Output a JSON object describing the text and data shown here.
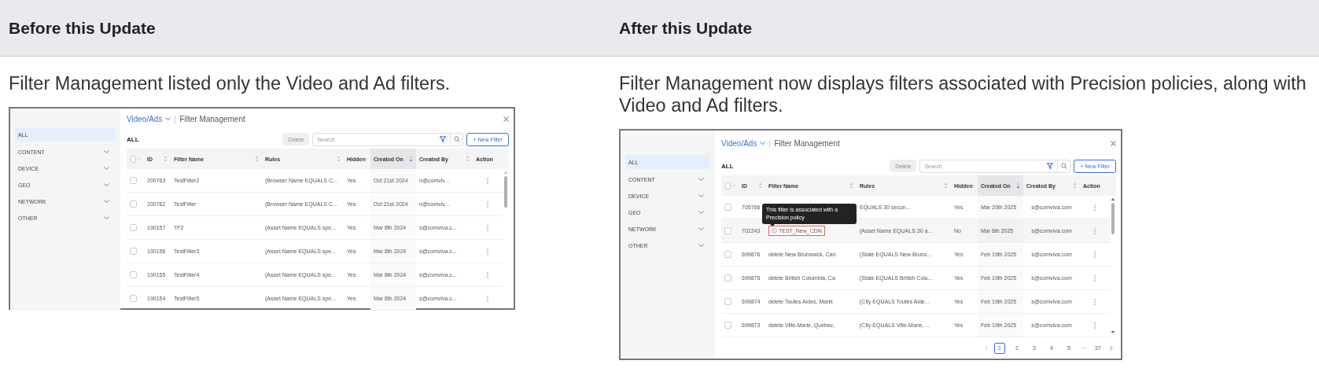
{
  "panels": [
    {
      "heading": "Before this Update",
      "description": "Filter Management listed only the Video and Ad filters.",
      "app": {
        "breadcrumb": "Video/Ads",
        "title": "Filter Management",
        "sidebar": [
          {
            "label": "ALL",
            "selected": true,
            "expandable": false
          },
          {
            "label": "CONTENT",
            "selected": false,
            "expandable": true
          },
          {
            "label": "DEVICE",
            "selected": false,
            "expandable": true
          },
          {
            "label": "GEO",
            "selected": false,
            "expandable": true
          },
          {
            "label": "NETWORK",
            "selected": false,
            "expandable": true
          },
          {
            "label": "OTHER",
            "selected": false,
            "expandable": true
          }
        ],
        "section": "ALL",
        "delete_button": {
          "label": "Delete",
          "disabled": true
        },
        "search": {
          "placeholder": "Search"
        },
        "new_button": "+ New Filter",
        "select_all": {
          "checked": false
        },
        "columns": [
          {
            "label": "ID",
            "sortable": true,
            "sorted": false
          },
          {
            "label": "Filter Name",
            "sortable": true,
            "sorted": false
          },
          {
            "label": "Rules",
            "sortable": true,
            "sorted": false
          },
          {
            "label": "Hidden",
            "sortable": true,
            "sorted": false
          },
          {
            "label": "Created On",
            "sortable": true,
            "sorted": true
          },
          {
            "label": "Created By",
            "sortable": true,
            "sorted": false
          },
          {
            "label": "Action",
            "sortable": false,
            "sorted": false
          }
        ],
        "rows": [
          {
            "checked": false,
            "id": "200763",
            "name": "TestFilter2",
            "rules": "(Browser Name EQUALS C...",
            "hidden": "Yes",
            "created_on": "Oct 21st 2024",
            "created_by": "n@comviv..."
          },
          {
            "checked": false,
            "id": "200762",
            "name": "TestFilter",
            "rules": "(Browser Name EQUALS C...",
            "hidden": "Yes",
            "created_on": "Oct 21st 2024",
            "created_by": "n@comviv..."
          },
          {
            "checked": false,
            "id": "190157",
            "name": "TF2",
            "rules": "(Asset Name EQUALS spe...",
            "hidden": "Yes",
            "created_on": "Mar 8th 2024",
            "created_by": "s@comviva.c..."
          },
          {
            "checked": false,
            "id": "190156",
            "name": "TestFilter3",
            "rules": "(Asset Name EQUALS spe...",
            "hidden": "Yes",
            "created_on": "Mar 8th 2024",
            "created_by": "s@comviva.c..."
          },
          {
            "checked": false,
            "id": "190155",
            "name": "TestFilter4",
            "rules": "(Asset Name EQUALS spe...",
            "hidden": "Yes",
            "created_on": "Mar 8th 2024",
            "created_by": "s@comviva.c..."
          },
          {
            "checked": false,
            "id": "190154",
            "name": "TestFilter5",
            "rules": "(Asset Name EQUALS spe...",
            "hidden": "Yes",
            "created_on": "Mar 8th 2024",
            "created_by": "s@comviva.c..."
          }
        ]
      }
    },
    {
      "heading": "After this Update",
      "description": "Filter Management now displays filters associated with Precision policies, along with Video and Ad filters.",
      "app": {
        "breadcrumb": "Video/Ads",
        "title": "Filter Management",
        "sidebar": [
          {
            "label": "ALL",
            "selected": true,
            "expandable": false
          },
          {
            "label": "CONTENT",
            "selected": false,
            "expandable": true
          },
          {
            "label": "DEVICE",
            "selected": false,
            "expandable": true
          },
          {
            "label": "GEO",
            "selected": false,
            "expandable": true
          },
          {
            "label": "NETWORK",
            "selected": false,
            "expandable": true
          },
          {
            "label": "OTHER",
            "selected": false,
            "expandable": true
          }
        ],
        "section": "ALL",
        "delete_button": {
          "label": "Delete",
          "disabled": true
        },
        "search": {
          "placeholder": "Search"
        },
        "new_button": "+ New Filter",
        "select_all": {
          "checked": false
        },
        "columns": [
          {
            "label": "ID",
            "sortable": true,
            "sorted": false
          },
          {
            "label": "Filter Name",
            "sortable": true,
            "sorted": false
          },
          {
            "label": "Rules",
            "sortable": true,
            "sorted": false
          },
          {
            "label": "Hidden",
            "sortable": true,
            "sorted": false
          },
          {
            "label": "Created On",
            "sortable": true,
            "sorted": true
          },
          {
            "label": "Created By",
            "sortable": true,
            "sorted": false
          },
          {
            "label": "Action",
            "sortable": false,
            "sorted": false
          }
        ],
        "rows": [
          {
            "checked": false,
            "id": "705766",
            "rules": "EQUALS 30 secon...",
            "hidden": "Yes",
            "created_on": "Mar 20th 2025",
            "created_by": "s@comviva.com",
            "hovered": false,
            "flagged": false
          },
          {
            "checked": false,
            "id": "702243",
            "name": "TEST_New_CDN",
            "rules": "(Asset Name EQUALS 30 a...",
            "hidden": "No",
            "created_on": "Mar 6th 2025",
            "created_by": "s@comviva.com",
            "hovered": true,
            "flagged": true,
            "tooltip": "This filter is associated with a Precision policy"
          },
          {
            "checked": false,
            "id": "699876",
            "name": "delete New Brunswick, Can",
            "rules": "(State EQUALS New Bruns...",
            "hidden": "Yes",
            "created_on": "Feb 19th 2025",
            "created_by": "s@comviva.com",
            "hovered": false,
            "flagged": false
          },
          {
            "checked": false,
            "id": "699875",
            "name": "delete British Columbia, Ca",
            "rules": "(State EQUALS British Colu...",
            "hidden": "Yes",
            "created_on": "Feb 19th 2025",
            "created_by": "s@comviva.com",
            "hovered": false,
            "flagged": false
          },
          {
            "checked": false,
            "id": "699874",
            "name": "delete Toutes Aides, Manit",
            "rules": "(City EQUALS Toutes Aide...",
            "hidden": "Yes",
            "created_on": "Feb 19th 2025",
            "created_by": "s@comviva.com",
            "hovered": false,
            "flagged": false
          },
          {
            "checked": false,
            "id": "699873",
            "name": "delete Ville-Marie, Quebec,",
            "rules": "(City EQUALS Ville-Marie, ...",
            "hidden": "Yes",
            "created_on": "Feb 19th 2025",
            "created_by": "s@comviva.com",
            "hovered": false,
            "flagged": false
          }
        ],
        "pagination": {
          "pages": [
            {
              "label": "1",
              "selected": true
            },
            {
              "label": "2",
              "selected": false
            },
            {
              "label": "3",
              "selected": false
            },
            {
              "label": "4",
              "selected": false
            },
            {
              "label": "5",
              "selected": false
            }
          ],
          "ellipsis": "···",
          "last": "37"
        }
      }
    }
  ]
}
